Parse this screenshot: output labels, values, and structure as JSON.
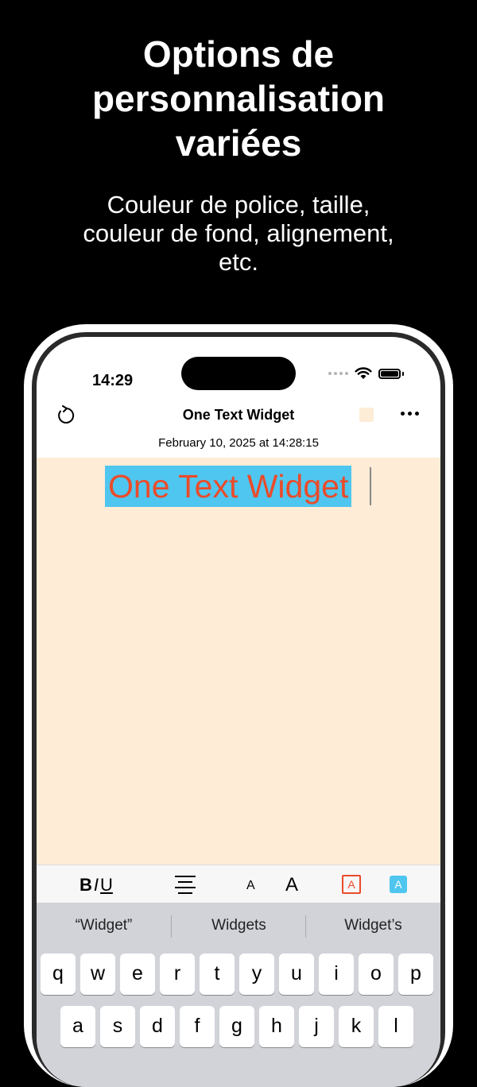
{
  "promo": {
    "title": "Options de\npersonnalisation\nvariées",
    "subtitle": "Couleur de police, taille,\ncouleur de fond, alignement,\netc."
  },
  "status_bar": {
    "time": "14:29"
  },
  "nav": {
    "title": "One Text Widget",
    "date": "February 10, 2025 at 14:28:15",
    "swatch_color": "#fdecd6"
  },
  "canvas": {
    "background": "#feecd6",
    "text": "One Text Widget",
    "text_color": "#ea4b2a",
    "highlight_color": "#4fc6ef"
  },
  "toolbar": {
    "bold": "B",
    "italic": "I",
    "underline": "U",
    "small_a": "A",
    "large_a": "A",
    "font_color_a": "A",
    "bg_color_a": "A"
  },
  "keyboard": {
    "suggestions": [
      "“Widget”",
      "Widgets",
      "Widget’s"
    ],
    "row1": [
      "q",
      "w",
      "e",
      "r",
      "t",
      "y",
      "u",
      "i",
      "o",
      "p"
    ],
    "row2": [
      "a",
      "s",
      "d",
      "f",
      "g",
      "h",
      "j",
      "k",
      "l"
    ]
  },
  "icons": {
    "refresh": "refresh-icon",
    "more": "more-icon",
    "wifi": "wifi-icon",
    "battery": "battery-icon",
    "align": "align-center-icon"
  }
}
